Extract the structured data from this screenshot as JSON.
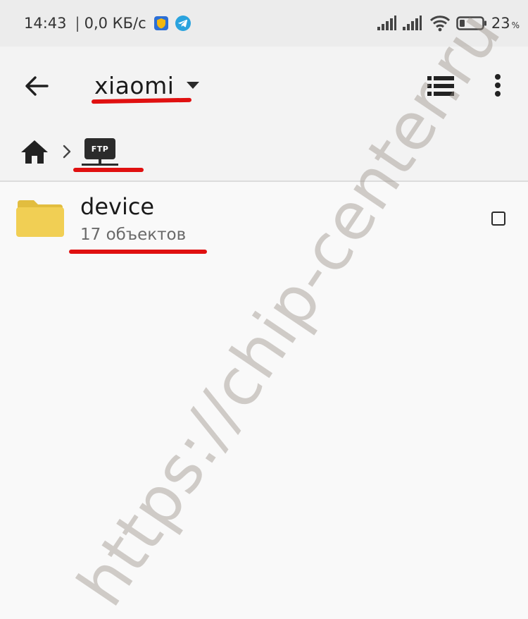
{
  "status_bar": {
    "time": "14:43",
    "separator": "|",
    "speed": "0,0 КБ/с",
    "battery_percent": "23",
    "battery_percent_sign": "%",
    "battery_level": 0.23
  },
  "toolbar": {
    "title": "xiaomi"
  },
  "breadcrumb": {
    "ftp_label": "FTP"
  },
  "file_list": {
    "items": [
      {
        "name": "device",
        "meta": "17 объектов",
        "checked": false
      }
    ]
  },
  "watermark": {
    "text": "https://chip-center.ru"
  },
  "colors": {
    "accent_underline": "#e01010",
    "folder": "#f1cf54",
    "telegram": "#2aa3de",
    "shield": "#f3b811"
  },
  "icons": [
    "back-arrow-icon",
    "dropdown-icon",
    "list-view-icon",
    "more-vert-icon",
    "home-icon",
    "chevron-right-icon",
    "ftp-icon",
    "folder-icon",
    "shield-icon",
    "telegram-icon",
    "signal-icon",
    "wifi-icon",
    "battery-icon"
  ]
}
